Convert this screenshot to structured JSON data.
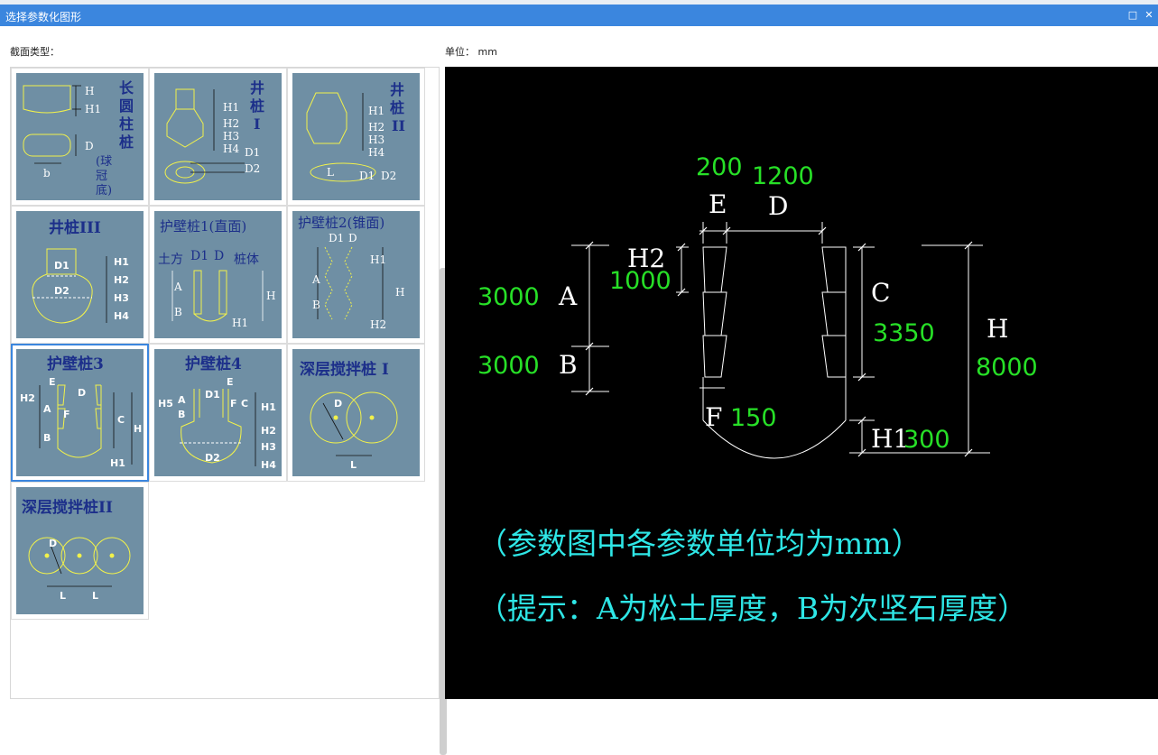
{
  "window": {
    "title": "选择参数化图形"
  },
  "labels": {
    "section_type": "截面类型：",
    "unit": "单位： mm"
  },
  "shapes": [
    {
      "title": "长圆柱桩(球冠底)",
      "dims": [
        "H",
        "H1",
        "D",
        "b"
      ]
    },
    {
      "title": "井桩I",
      "dims": [
        "H1",
        "H2",
        "H3",
        "H4",
        "D1",
        "D2"
      ]
    },
    {
      "title": "井桩II",
      "dims": [
        "H1",
        "H2",
        "H3",
        "H4",
        "L",
        "D1",
        "D2"
      ]
    },
    {
      "title": "井桩III",
      "dims": [
        "D1",
        "D2",
        "H1",
        "H2",
        "H3",
        "H4"
      ]
    },
    {
      "title": "护壁桩1(直面)",
      "dims": [
        "土方",
        "D1",
        "D",
        "桩体",
        "A",
        "B",
        "H",
        "H1"
      ]
    },
    {
      "title": "护壁桩2(锥面)",
      "dims": [
        "D1",
        "D",
        "A",
        "B",
        "H1",
        "H",
        "H2"
      ]
    },
    {
      "title": "护壁桩3",
      "dims": [
        "E",
        "D",
        "H2",
        "A",
        "F",
        "B",
        "C",
        "H",
        "H1"
      ]
    },
    {
      "title": "护壁桩4",
      "dims": [
        "E",
        "H5",
        "A",
        "B",
        "D1",
        "F",
        "C",
        "H1",
        "H2",
        "H3",
        "H4",
        "D2"
      ]
    },
    {
      "title": "深层搅拌桩 I",
      "dims": [
        "D",
        "L"
      ]
    },
    {
      "title": "深层搅拌桩II",
      "dims": [
        "D",
        "L",
        "L"
      ]
    }
  ],
  "preview": {
    "params": {
      "E": {
        "label": "E",
        "value": "200"
      },
      "D": {
        "label": "D",
        "value": "1200"
      },
      "H2": {
        "label": "H2",
        "value": "1000"
      },
      "A": {
        "label": "A",
        "value": "3000"
      },
      "B": {
        "label": "B",
        "value": "3000"
      },
      "C": {
        "label": "C",
        "value": "3350"
      },
      "H": {
        "label": "H",
        "value": "8000"
      },
      "F": {
        "label": "F",
        "value": "150"
      },
      "H1": {
        "label": "H1",
        "value": "300"
      }
    },
    "note1": "（参数图中各参数单位均为mm）",
    "note2": "（提示：A为松土厚度，B为次坚石厚度）"
  },
  "colors": {
    "titlebar": "#3b86de",
    "thumb_bg": "#6f8fa4",
    "shape_line": "#f2f24a",
    "title_text": "#1c2f8a",
    "value_green": "#27e027",
    "note_cyan": "#2ee6e6"
  }
}
